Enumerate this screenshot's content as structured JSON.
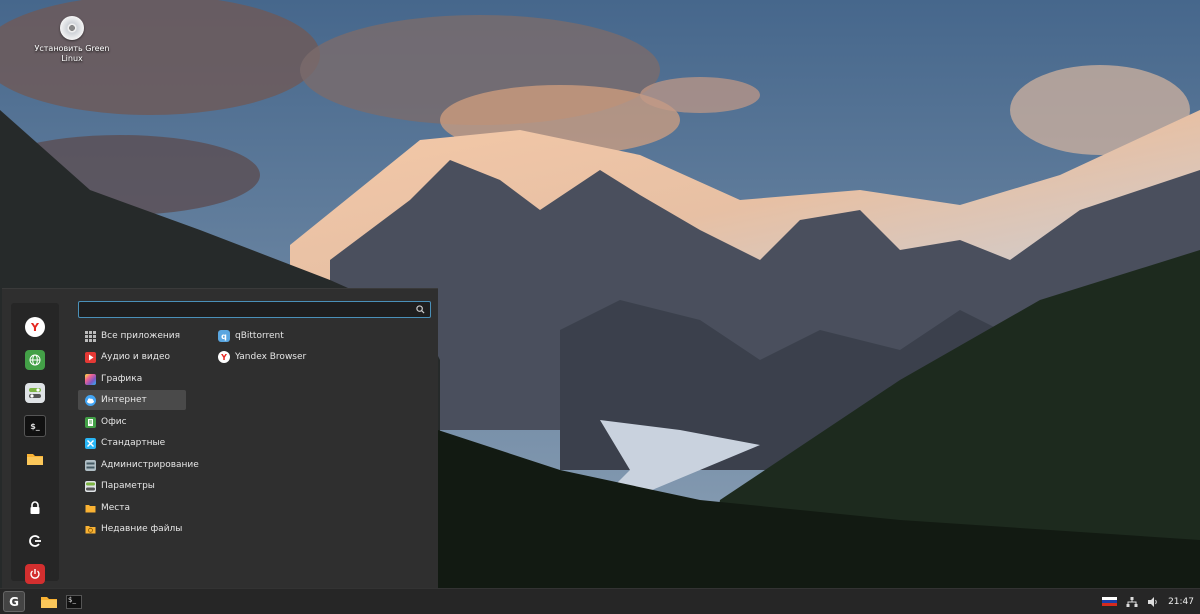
{
  "desktop": {
    "icons": [
      {
        "label": "Установить Green Linux",
        "icon": "disc-icon"
      }
    ]
  },
  "menu": {
    "search": {
      "value": "",
      "placeholder": ""
    },
    "favorites": [
      {
        "name": "yandex-browser-icon"
      },
      {
        "name": "globe-icon"
      },
      {
        "name": "settings-toggle-icon"
      },
      {
        "name": "terminal-icon"
      },
      {
        "name": "folder-icon"
      },
      {
        "name": "lock-icon"
      },
      {
        "name": "logout-icon"
      },
      {
        "name": "power-icon"
      }
    ],
    "categories": [
      {
        "label": "Все приложения",
        "icon": "grid-icon",
        "color": "#bbbbbb"
      },
      {
        "label": "Аудио и видео",
        "icon": "play-icon",
        "color": "#e53935"
      },
      {
        "label": "Графика",
        "icon": "palette-icon",
        "color": "#f06292"
      },
      {
        "label": "Интернет",
        "icon": "cloud-icon",
        "color": "#42a5f5"
      },
      {
        "label": "Офис",
        "icon": "document-icon",
        "color": "#43a047"
      },
      {
        "label": "Стандартные",
        "icon": "tools-icon",
        "color": "#29b6f6"
      },
      {
        "label": "Администрирование",
        "icon": "admin-icon",
        "color": "#b0bec5"
      },
      {
        "label": "Параметры",
        "icon": "settings-toggle-icon",
        "color": "#9ccc65"
      },
      {
        "label": "Места",
        "icon": "folder-icon",
        "color": "#f9b233"
      },
      {
        "label": "Недавние файлы",
        "icon": "recent-folder-icon",
        "color": "#f9b233"
      }
    ],
    "active_category": "Интернет",
    "apps": [
      {
        "label": "qBittorrent",
        "icon": "qbittorrent-icon",
        "color": "#5aa6e0"
      },
      {
        "label": "Yandex Browser",
        "icon": "yandex-browser-icon",
        "color": "#ffffff"
      }
    ]
  },
  "taskbar": {
    "menu_button": "G",
    "clock": "21:47",
    "keyboard_layout_flag": [
      "#ffffff",
      "#1c3fa8",
      "#d52b1e"
    ]
  },
  "colors": {
    "accent": "#4a90b8",
    "panel": "#2f2f2f",
    "taskbar": "#262626"
  }
}
